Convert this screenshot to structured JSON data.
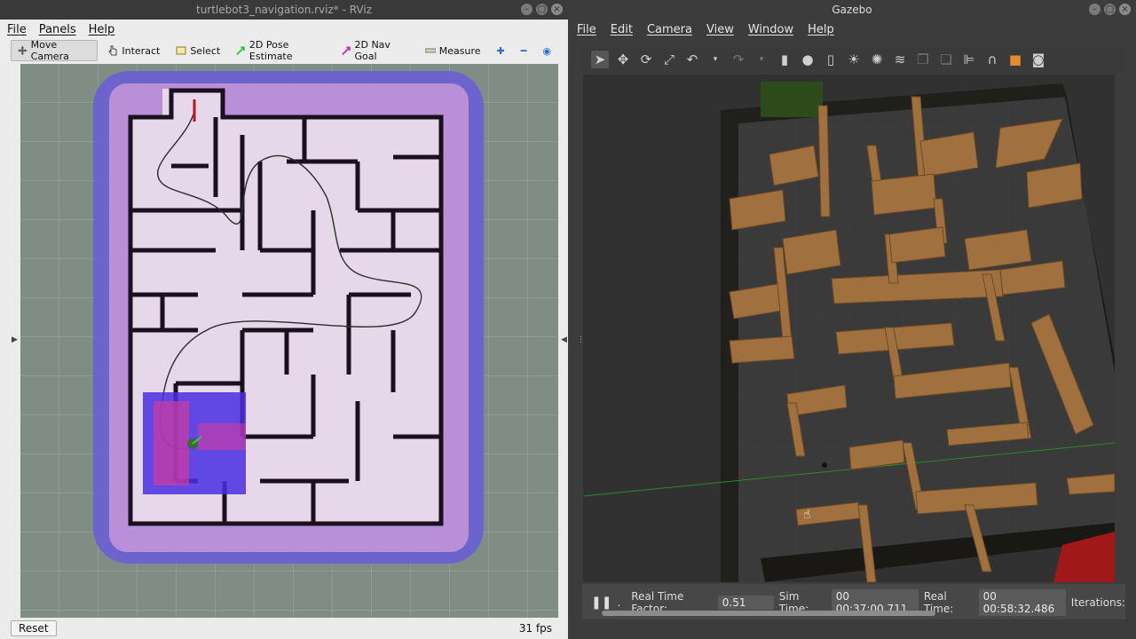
{
  "rviz": {
    "title": "turtlebot3_navigation.rviz* - RViz",
    "menu": [
      "File",
      "Panels",
      "Help"
    ],
    "tools": [
      {
        "label": "Move Camera",
        "icon": "move-camera-icon"
      },
      {
        "label": "Interact",
        "icon": "interact-icon"
      },
      {
        "label": "Select",
        "icon": "select-icon"
      },
      {
        "label": "2D Pose Estimate",
        "icon": "pose-estimate-icon"
      },
      {
        "label": "2D Nav Goal",
        "icon": "nav-goal-icon"
      },
      {
        "label": "Measure",
        "icon": "measure-icon"
      }
    ],
    "reset_label": "Reset",
    "fps": "31 fps"
  },
  "gazebo": {
    "title": "Gazebo",
    "menu": [
      "File",
      "Edit",
      "Camera",
      "View",
      "Window",
      "Help"
    ],
    "real_time_factor_label": "Real Time Factor:",
    "real_time_factor": "0.51",
    "sim_time_label": "Sim Time:",
    "sim_time": "00 00:37:00.711",
    "real_time_label": "Real Time:",
    "real_time": "00 00:58:32.486",
    "iterations_label": "Iterations:"
  },
  "colors": {
    "map_free": "#e7d7ea",
    "map_cost": "#6a5fd0",
    "wall_wood": "#a0713f",
    "grid": "#3e3e3e"
  }
}
